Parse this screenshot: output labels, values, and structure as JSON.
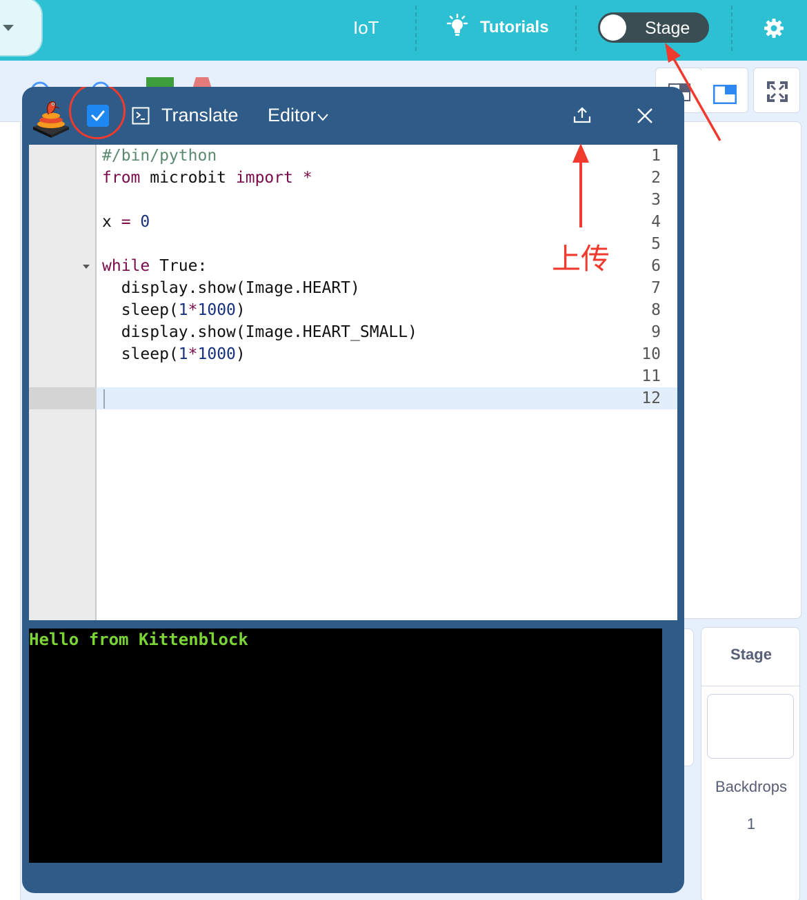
{
  "menubar": {
    "iot_label": "IoT",
    "tutorials_label": "Tutorials",
    "stage_toggle_label": "Stage",
    "stage_toggle_on": false
  },
  "editor": {
    "title": "Translate",
    "editor_menu_label": "Editor",
    "checkbox_checked": true,
    "line_numbers": [
      "1",
      "2",
      "3",
      "4",
      "5",
      "6",
      "7",
      "8",
      "9",
      "10",
      "11",
      "12"
    ],
    "code": {
      "line1": "#/bin/python",
      "line2_kw1": "from",
      "line2_mid": " microbit ",
      "line2_kw2": "import",
      "line2_star": " *",
      "line4_var": "x ",
      "line4_op": "=",
      "line4_num": " 0",
      "line6_kw": "while",
      "line6_rest": " True:",
      "line7": "  display.show(Image.HEART)",
      "line8_a": "  sleep(",
      "line8_num1": "1",
      "line8_op": "*",
      "line8_num2": "1000",
      "line8_b": ")",
      "line9": "  display.show(Image.HEART_SMALL)",
      "line10_a": "  sleep(",
      "line10_num1": "1",
      "line10_op": "*",
      "line10_num2": "1000",
      "line10_b": ")"
    },
    "active_line": 12,
    "console_output": "Hello from Kittenblock"
  },
  "annotation": {
    "upload_label": "上传"
  },
  "stage_panel": {
    "title": "Stage",
    "backdrops_label": "Backdrops",
    "backdrops_count": "1"
  },
  "colors": {
    "menubar": "#2cc0d2",
    "window": "#2e5b87",
    "annotation_red": "#f03a2e",
    "console_text": "#7bd436"
  },
  "icons": [
    "caret-down-icon",
    "lightbulb-icon",
    "gear-icon",
    "python-logo-icon",
    "check-icon",
    "terminal-icon",
    "upload-icon",
    "close-icon",
    "layout-small-stage-icon",
    "layout-large-stage-icon",
    "fullscreen-icon"
  ]
}
